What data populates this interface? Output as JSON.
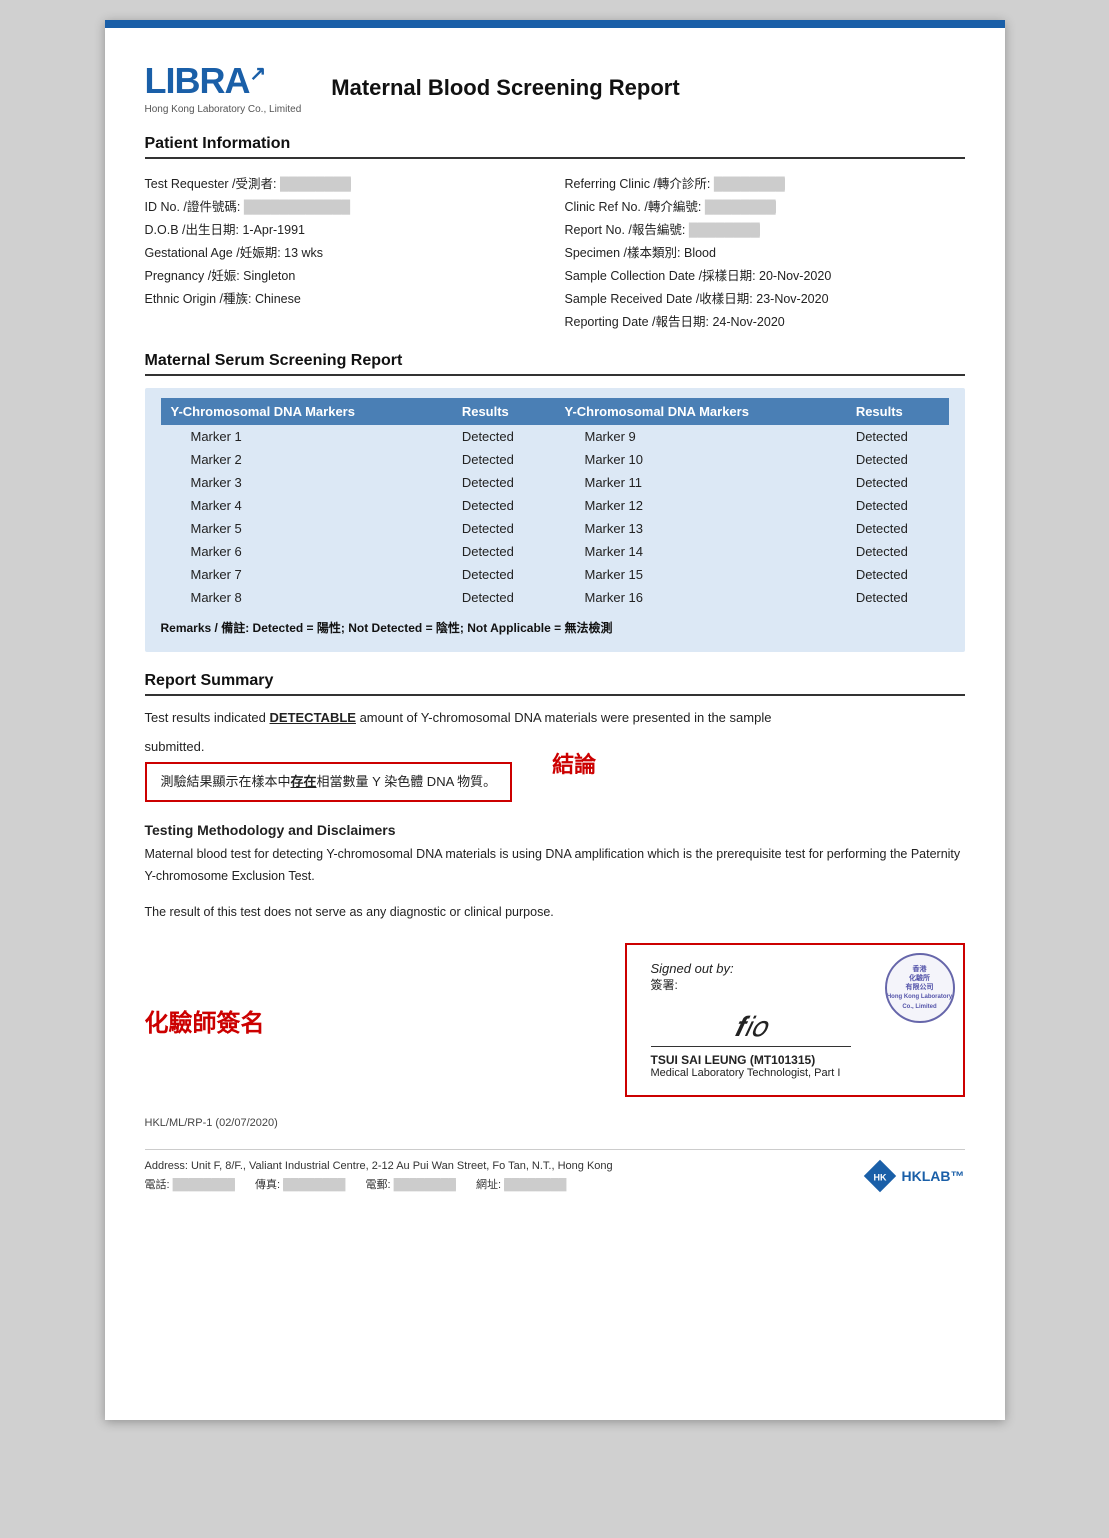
{
  "header": {
    "logo_name": "LIBRA",
    "logo_sub": "Hong Kong Laboratory Co., Limited",
    "report_title": "Maternal Blood Screening Report"
  },
  "patient_info": {
    "section_label": "Patient Information",
    "fields_left": [
      {
        "label": "Test Requester /受測者:",
        "value": "████████"
      },
      {
        "label": "ID No. /證件號碼:",
        "value": "████████████"
      },
      {
        "label": "D.O.B /出生日期:",
        "value": "1-Apr-1991"
      },
      {
        "label": "Gestational Age /妊娠期:",
        "value": "13 wks"
      },
      {
        "label": "Pregnancy /妊娠:",
        "value": "Singleton"
      },
      {
        "label": "Ethnic Origin /種族:",
        "value": "Chinese"
      }
    ],
    "fields_right": [
      {
        "label": "Referring Clinic /轉介診所:",
        "value": "████████"
      },
      {
        "label": "Clinic Ref No. /轉介編號:",
        "value": "████████"
      },
      {
        "label": "Report No. /報告編號:",
        "value": "████████"
      },
      {
        "label": "Specimen /樣本類別:",
        "value": "Blood"
      },
      {
        "label": "Sample Collection Date /採樣日期:",
        "value": "20-Nov-2020"
      },
      {
        "label": "Sample Received Date /收樣日期:",
        "value": "23-Nov-2020"
      },
      {
        "label": "Reporting Date /報告日期:",
        "value": "24-Nov-2020"
      }
    ]
  },
  "serum_section": {
    "section_label": "Maternal Serum Screening Report",
    "col1_header": "Y-Chromosomal DNA Markers",
    "col2_header": "Results",
    "col3_header": "Y-Chromosomal DNA Markers",
    "col4_header": "Results",
    "rows": [
      {
        "marker_left": "Marker 1",
        "result_left": "Detected",
        "marker_right": "Marker 9",
        "result_right": "Detected"
      },
      {
        "marker_left": "Marker 2",
        "result_left": "Detected",
        "marker_right": "Marker 10",
        "result_right": "Detected"
      },
      {
        "marker_left": "Marker 3",
        "result_left": "Detected",
        "marker_right": "Marker 11",
        "result_right": "Detected"
      },
      {
        "marker_left": "Marker 4",
        "result_left": "Detected",
        "marker_right": "Marker 12",
        "result_right": "Detected"
      },
      {
        "marker_left": "Marker 5",
        "result_left": "Detected",
        "marker_right": "Marker 13",
        "result_right": "Detected"
      },
      {
        "marker_left": "Marker 6",
        "result_left": "Detected",
        "marker_right": "Marker 14",
        "result_right": "Detected"
      },
      {
        "marker_left": "Marker 7",
        "result_left": "Detected",
        "marker_right": "Marker 15",
        "result_right": "Detected"
      },
      {
        "marker_left": "Marker 8",
        "result_left": "Detected",
        "marker_right": "Marker 16",
        "result_right": "Detected"
      }
    ],
    "remarks": "Remarks / 備註: Detected = 陽性; Not Detected = 陰性; Not Applicable = 無法檢測"
  },
  "report_summary": {
    "section_label": "Report Summary",
    "summary_line1": "Test results indicated ",
    "detectable_word": "DETECTABLE",
    "summary_line2": " amount of Y-chromosomal DNA materials were presented in the sample",
    "summary_line3": "submitted.",
    "box_line1": "測驗結果顯示在樣本中",
    "box_underline": "存在",
    "box_line2": "相當數量 Y 染色體 DNA 物質。",
    "conclusion_label": "結論"
  },
  "methodology": {
    "title": "Testing Methodology and Disclaimers",
    "para1": "Maternal blood test for detecting Y-chromosomal DNA materials is using DNA amplification which is the prerequisite test for performing the Paternity Y-chromosome Exclusion Test.",
    "para2": "The result of this test does not serve as any diagnostic or clinical purpose."
  },
  "signature": {
    "left_label": "化驗師簽名",
    "signed_out_label": "Signed out by:",
    "signed_chinese": "簽署:",
    "sig_graphic": "𝒇𝑖𝑜",
    "signer_name": "TSUI SAI LEUNG (MT101315)",
    "signer_title": "Medical Laboratory Technologist, Part I",
    "stamp_line1": "香港",
    "stamp_line2": "化驗所",
    "stamp_line3": "有限公司",
    "stamp_line4": "Hong Kong Laboratory",
    "stamp_line5": "Co., Limited"
  },
  "footer": {
    "ref": "HKL/ML/RP-1 (02/07/2020)",
    "address": "Address: Unit F, 8/F., Valiant Industrial Centre, 2-12 Au Pui Wan Street, Fo Tan, N.T., Hong Kong",
    "phone1": "電話: ████████████",
    "phone2": "傳真: ████████████",
    "email": "電郵: ████████████",
    "website": "網址: ████████████"
  }
}
